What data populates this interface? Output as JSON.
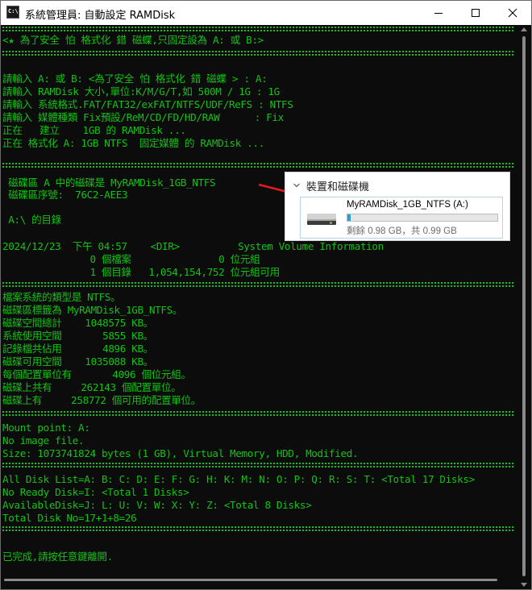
{
  "window": {
    "title": "系統管理員: 自動設定 RAMDisk",
    "icon": "cmd-icon",
    "icon_text": "C:\\",
    "controls": [
      "minimize-icon",
      "maximize-icon",
      "close-icon"
    ]
  },
  "console": {
    "lines": [
      "<★ 為了安全 怕 格式化 錯 磁蝶,只固定設為 A: 或 B:>",
      "請輸入 A: 或 B: <為了安全 怕 格式化 錯 磁蝶 > : A:",
      "請輸入 RAMDisk 大小,單位:K/M/G/T,如 500M / 1G : 1G",
      "請輸入 系統格式.FAT/FAT32/exFAT/NTFS/UDF/ReFS : NTFS",
      "請輸入 媒體種類 Fix預設/ReM/CD/FD/HD/RAW      : Fix",
      "正在   建立    1GB 的 RAMDisk ...",
      "正在 格式化 A: 1GB NTFS  固定媒體 的 RAMDisk ...",
      " 磁碟區 A 中的磁碟是 MyRAMDisk_1GB_NTFS",
      " 磁碟區序號:  76C2-AEE3",
      " A:\\ 的目錄",
      "2024/12/23  下午 04:57    <DIR>          System Volume Information",
      "               0 個檔案               0 位元組",
      "               1 個目錄   1,054,154,752 位元組可用",
      "檔案系統的類型是 NTFS。",
      "磁碟區標籤為 MyRAMDisk_1GB_NTFS。",
      "磁碟空間總計    1048575 KB。",
      "系統使用空間       5855 KB。",
      "記錄檔共佔用       4896 KB。",
      "磁碟可用空間    1035088 KB。",
      "每個配置單位有       4096 個位元組。",
      "磁碟上共有     262143 個配置單位。",
      "磁碟上有     258772 個可用的配置單位。",
      "Mount point: A:",
      "No image file.",
      "Size: 1073741824 bytes (1 GB), Virtual Memory, HDD, Modified.",
      "All Disk List=A: B: C: D: E: F: G: H: K: M: N: O: P: Q: R: S: T: <Total 17 Disks>",
      "No Ready Disk=I: <Total 1 Disks>",
      "AvailableDisk=J: L: U: V: W: X: Y: Z: <Total 8 Disks>",
      "Total Disk No=17+1+8=26",
      "已完成,請按任意鍵離開."
    ]
  },
  "overlay": {
    "section_title": "裝置和磁碟機",
    "drive_name": "MyRAMDisk_1GB_NTFS (A:)",
    "drive_space": "剩餘 0.98 GB，共 0.99 GB",
    "used_fraction": 0.02,
    "arrow_color": "#e8191a",
    "fill_color": "#26a0da"
  },
  "colors": {
    "console_bg": "#0c0c0c",
    "console_text": "#13c313"
  }
}
